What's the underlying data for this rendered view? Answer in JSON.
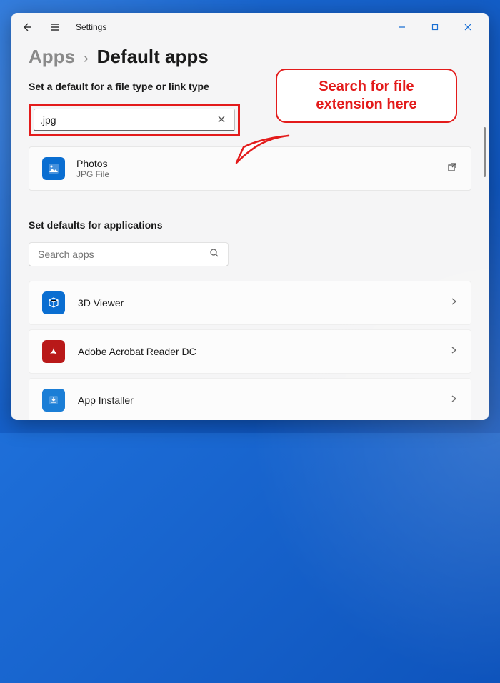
{
  "titlebar": {
    "title": "Settings"
  },
  "breadcrumb": {
    "parent": "Apps",
    "separator": "›",
    "current": "Default apps"
  },
  "section_filetype": {
    "label": "Set a default for a file type or link type",
    "search_value": ".jpg",
    "result": {
      "app_name": "Photos",
      "subtitle": "JPG File"
    }
  },
  "section_apps": {
    "label": "Set defaults for applications",
    "search_placeholder": "Search apps",
    "list": [
      {
        "name": "3D Viewer"
      },
      {
        "name": "Adobe Acrobat Reader DC"
      },
      {
        "name": "App Installer"
      }
    ]
  },
  "callout": {
    "text": "Search for file extension here"
  }
}
